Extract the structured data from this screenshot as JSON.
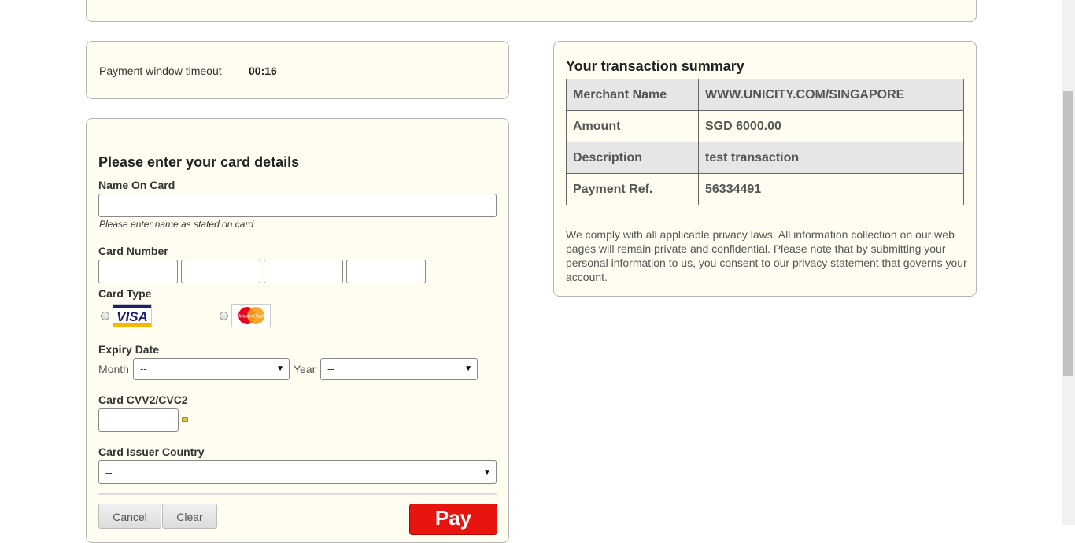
{
  "timeout": {
    "label": "Payment window timeout",
    "value": "00:16"
  },
  "card_form": {
    "title": "Please enter your card details",
    "name_label": "Name On Card",
    "name_value": "",
    "name_hint": "Please enter name as stated on card",
    "number_label": "Card Number",
    "card_type_label": "Card Type",
    "card_types": [
      {
        "name": "VISA",
        "icon": "visa-logo",
        "selected": false
      },
      {
        "name": "MasterCard",
        "icon": "mastercard-logo",
        "selected": false
      }
    ],
    "expiry_label": "Expiry Date",
    "month_label": "Month",
    "month_value": "--",
    "year_label": "Year",
    "year_value": "--",
    "cvv_label": "Card CVV2/CVC2",
    "issuer_label": "Card Issuer Country",
    "issuer_value": "--",
    "cancel_label": "Cancel",
    "clear_label": "Clear",
    "pay_label": "Pay"
  },
  "summary": {
    "title": "Your transaction summary",
    "rows": [
      {
        "key": "Merchant Name",
        "value": "WWW.UNICITY.COM/SINGAPORE"
      },
      {
        "key": "Amount",
        "value": "SGD 6000.00"
      },
      {
        "key": "Description",
        "value": "test transaction"
      },
      {
        "key": "Payment Ref.",
        "value": "56334491"
      }
    ],
    "privacy": "We comply with all applicable privacy laws. All information collection on our web pages will remain private and confidential. Please note that by submitting your personal information to us, you consent to our privacy statement that governs your account."
  },
  "colors": {
    "panel_bg": "#fffdf0",
    "pay_button": "#e8140f",
    "table_shade": "#e6e6e6"
  }
}
